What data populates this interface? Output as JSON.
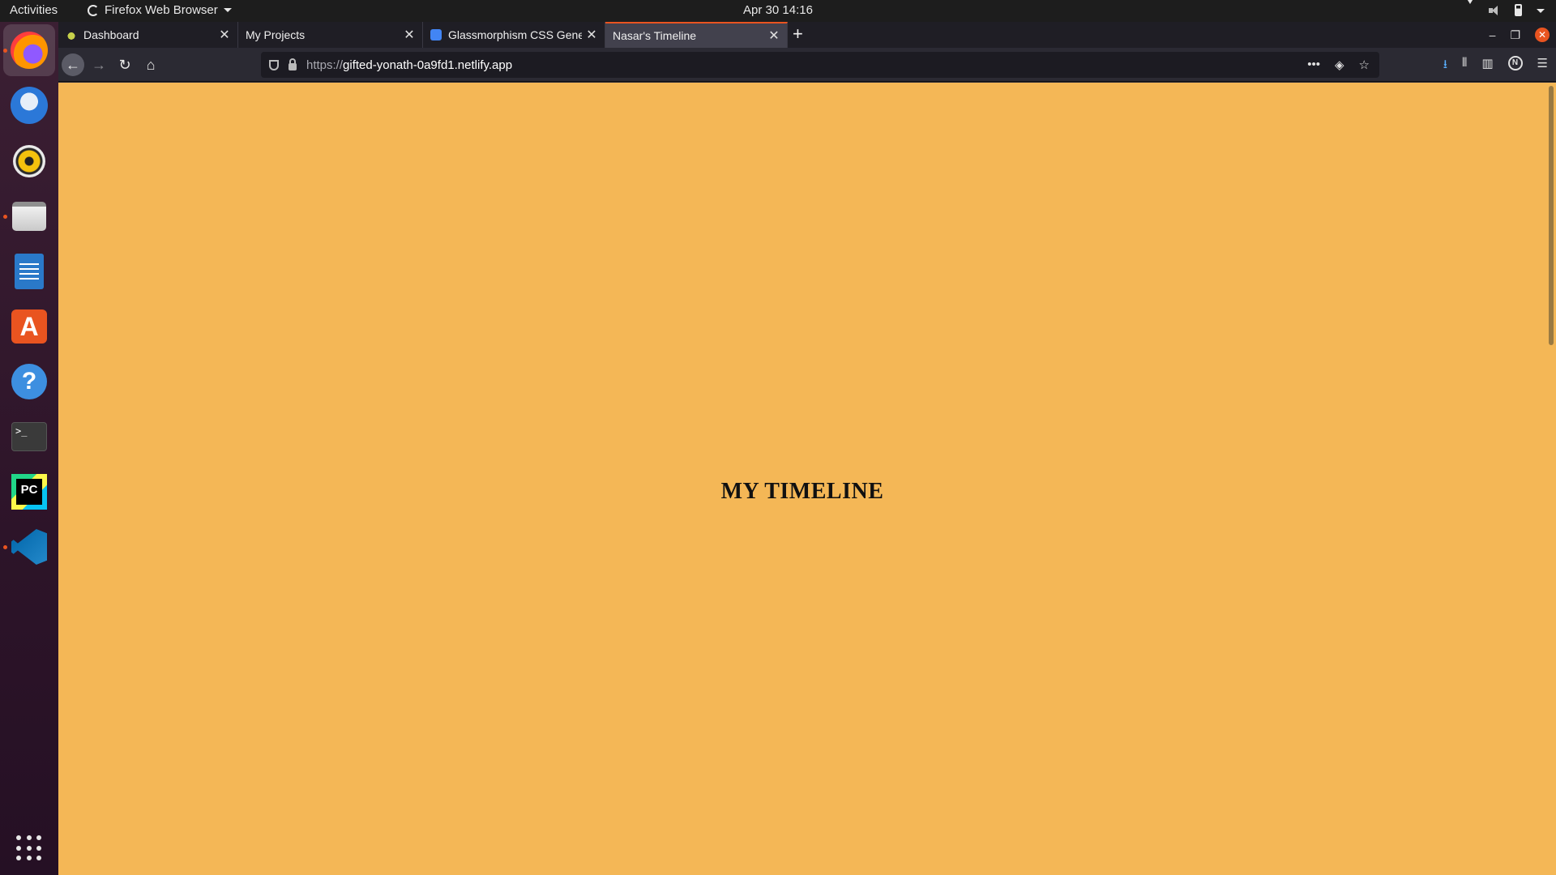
{
  "topbar": {
    "activities": "Activities",
    "app_name": "Firefox Web Browser",
    "clock": "Apr 30  14:16"
  },
  "dock": {
    "items": [
      {
        "name": "firefox",
        "icon": "firefox-icon"
      },
      {
        "name": "thunderbird",
        "icon": "thunderbird-icon"
      },
      {
        "name": "rhythmbox",
        "icon": "rhythmbox-icon"
      },
      {
        "name": "files",
        "icon": "files-icon"
      },
      {
        "name": "libreoffice-writer",
        "icon": "writer-icon"
      },
      {
        "name": "ubuntu-software",
        "icon": "software-store-icon"
      },
      {
        "name": "help",
        "icon": "help-icon"
      },
      {
        "name": "terminal",
        "icon": "terminal-icon"
      },
      {
        "name": "pycharm",
        "icon": "pycharm-icon"
      },
      {
        "name": "vscode",
        "icon": "vscode-icon"
      }
    ],
    "apps_grid": "show-applications-icon",
    "terminal_glyph": ">_",
    "pycharm_glyph": "PC",
    "store_glyph": "A",
    "help_glyph": "?"
  },
  "browser": {
    "tabs": [
      {
        "label": "Dashboard"
      },
      {
        "label": "My Projects"
      },
      {
        "label": "Glassmorphism CSS Generator"
      },
      {
        "label": "Nasar's Timeline"
      }
    ],
    "url_scheme": "https://",
    "url_domain": "gifted-yonath-0a9fd1.netlify.app",
    "colors": {
      "page_bg": "#f4b756",
      "accent": "#e95420"
    }
  },
  "page": {
    "heading": "MY TIMELINE"
  }
}
